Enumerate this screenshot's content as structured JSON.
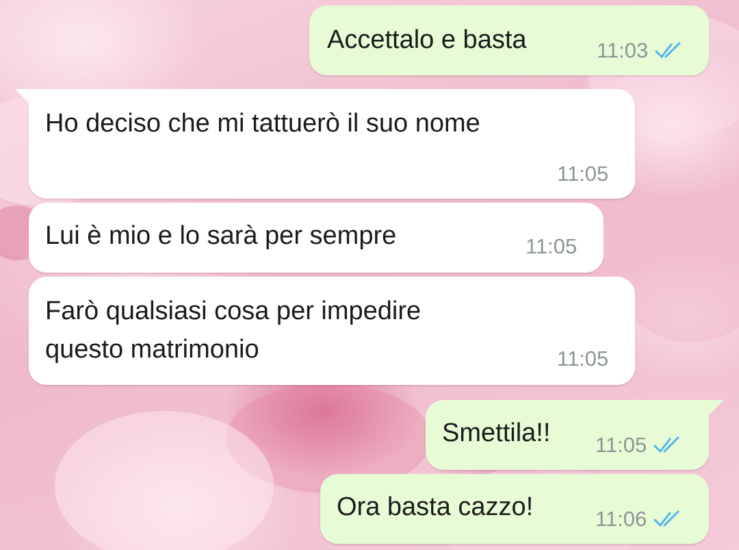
{
  "messages": [
    {
      "direction": "outgoing",
      "text": "Accettalo e basta",
      "time": "11:03",
      "status_icon": "double-check-read-icon"
    },
    {
      "direction": "incoming",
      "text": "Ho deciso che mi tattuerò il suo nome",
      "time": "11:05"
    },
    {
      "direction": "incoming",
      "text": "Lui è mio e lo sarà per sempre",
      "time": "11:05"
    },
    {
      "direction": "incoming",
      "text": "Farò qualsiasi cosa per impedire\nquesto matrimonio",
      "time": "11:05"
    },
    {
      "direction": "outgoing",
      "text": "Smettila!!",
      "time": "11:05",
      "status_icon": "double-check-read-icon"
    },
    {
      "direction": "outgoing",
      "text": "Ora basta cazzo!",
      "time": "11:06",
      "status_icon": "double-check-read-icon"
    }
  ],
  "colors": {
    "incoming_bubble": "#ffffff",
    "outgoing_bubble": "#e7fcd6",
    "read_ticks": "#4fb6ec",
    "timestamp": "#8c9596",
    "text": "#1b1b1b"
  }
}
